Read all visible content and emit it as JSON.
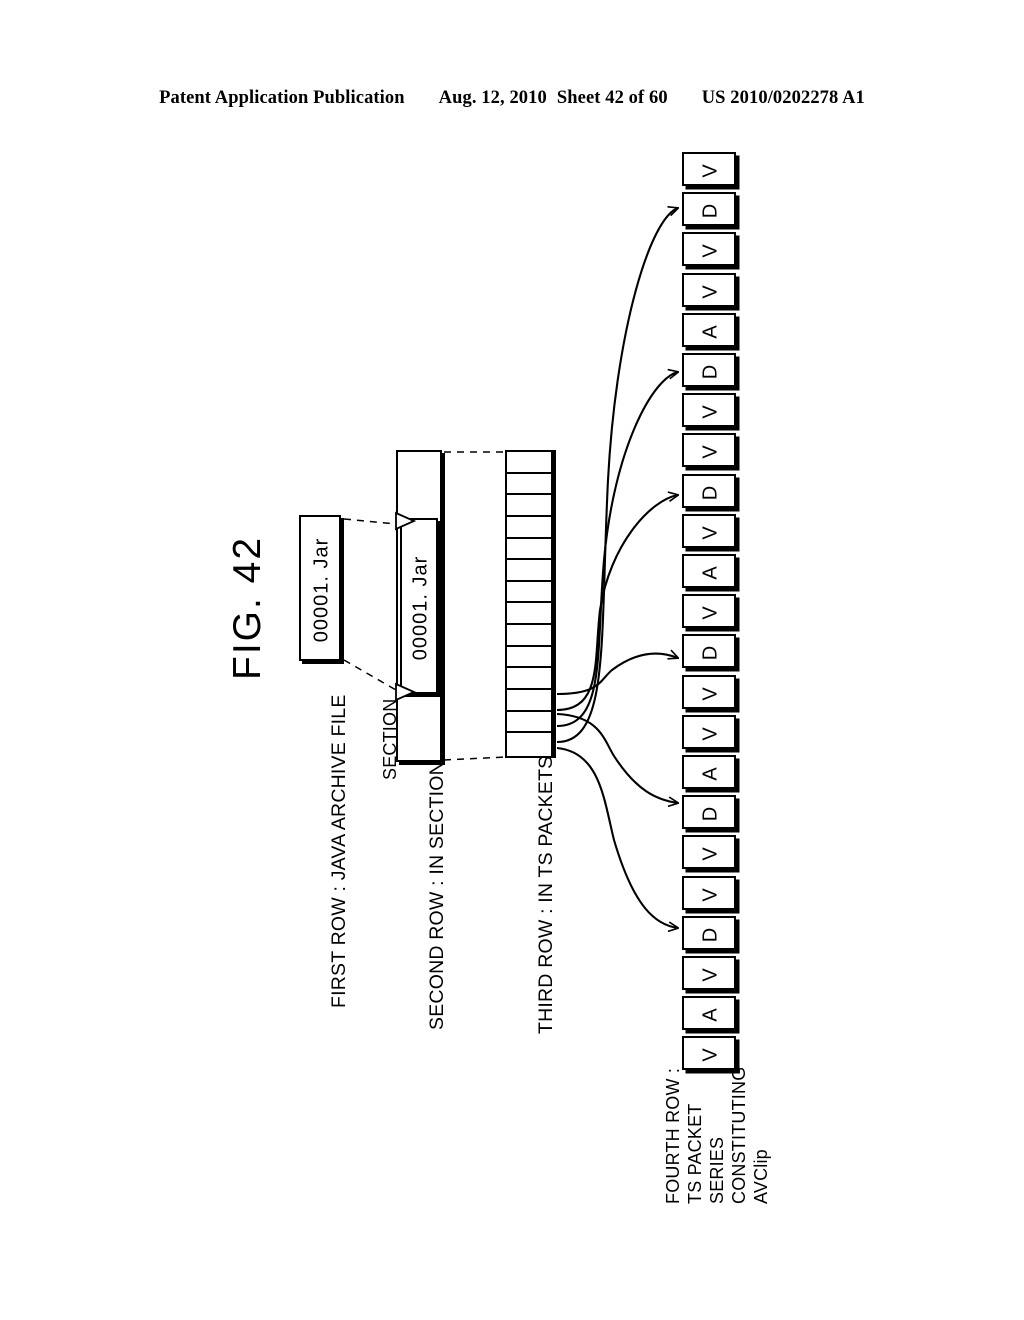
{
  "header": {
    "publication": "Patent Application Publication",
    "date": "Aug. 12, 2010",
    "sheet": "Sheet 42 of 60",
    "number": "US 2010/0202278 A1"
  },
  "figure": {
    "label": "FIG. 42"
  },
  "rows": {
    "first_row_caption": "FIRST ROW : JAVA ARCHIVE FILE",
    "section_caption": "SECTION",
    "second_row_caption": "SECOND ROW : IN SECTIONS",
    "third_row_caption": "THIRD ROW : IN TS PACKETS",
    "fourth_row_caption_lines": [
      "FOURTH ROW :",
      "TS PACKET",
      "SERIES",
      "CONSTITUTING",
      "AVClip"
    ]
  },
  "jar_boxes": {
    "first": "00001. Jar",
    "second": "00001. Jar"
  },
  "ts_column": {
    "cell_count": 14
  },
  "packet_series": {
    "labels": [
      "V",
      "D",
      "V",
      "V",
      "A",
      "D",
      "V",
      "V",
      "D",
      "V",
      "A",
      "V",
      "D",
      "V",
      "V",
      "A",
      "D",
      "V",
      "V",
      "D",
      "V",
      "A",
      "V"
    ],
    "arrow_target_indices": [
      1,
      5,
      8,
      12,
      16,
      19
    ]
  },
  "colors": {
    "stroke": "#000000",
    "background": "#ffffff"
  }
}
